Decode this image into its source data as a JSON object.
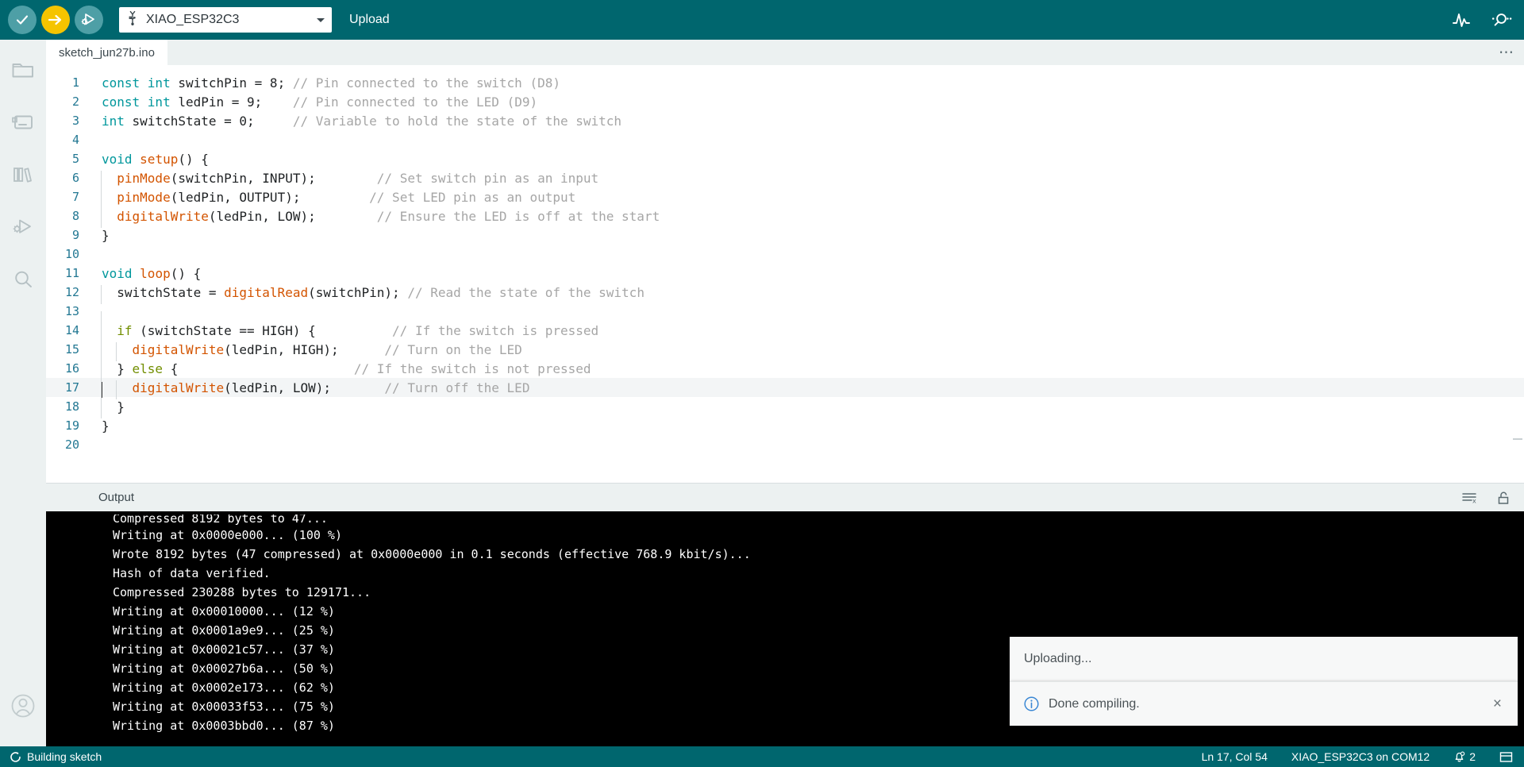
{
  "toolbar": {
    "verify_tooltip": "Verify",
    "upload_tooltip": "Upload",
    "debug_tooltip": "Debug",
    "board_name": "XIAO_ESP32C3",
    "upload_label": "Upload",
    "serial_plotter_tooltip": "Serial Plotter",
    "serial_monitor_tooltip": "Serial Monitor",
    "colors": {
      "teal": "#00666e",
      "yellow": "#f5c400",
      "muted_teal": "#4e9fa6"
    }
  },
  "sidebar": {
    "items": [
      {
        "name": "sketchbook",
        "icon": "folder-icon"
      },
      {
        "name": "boards-manager",
        "icon": "board-icon"
      },
      {
        "name": "library-manager",
        "icon": "library-icon"
      },
      {
        "name": "debug",
        "icon": "debug-icon"
      },
      {
        "name": "search",
        "icon": "search-icon"
      }
    ],
    "account_icon": "account-icon"
  },
  "tabs": {
    "active": "sketch_jun27b.ino",
    "items": [
      {
        "label": "sketch_jun27b.ino"
      }
    ],
    "overflow_label": "⋯"
  },
  "editor": {
    "active_line": 17,
    "lines": [
      {
        "n": 1,
        "tokens": [
          {
            "t": "const ",
            "c": "type"
          },
          {
            "t": "int ",
            "c": "type"
          },
          {
            "t": "switchPin = ",
            "c": "plain"
          },
          {
            "t": "8",
            "c": "num"
          },
          {
            "t": "; ",
            "c": "plain"
          },
          {
            "t": "// Pin connected to the switch (D8)",
            "c": "cmt"
          }
        ]
      },
      {
        "n": 2,
        "tokens": [
          {
            "t": "const ",
            "c": "type"
          },
          {
            "t": "int ",
            "c": "type"
          },
          {
            "t": "ledPin = ",
            "c": "plain"
          },
          {
            "t": "9",
            "c": "num"
          },
          {
            "t": ";    ",
            "c": "plain"
          },
          {
            "t": "// Pin connected to the LED (D9)",
            "c": "cmt"
          }
        ]
      },
      {
        "n": 3,
        "tokens": [
          {
            "t": "int ",
            "c": "type"
          },
          {
            "t": "switchState = ",
            "c": "plain"
          },
          {
            "t": "0",
            "c": "num"
          },
          {
            "t": ";     ",
            "c": "plain"
          },
          {
            "t": "// Variable to hold the state of the switch",
            "c": "cmt"
          }
        ]
      },
      {
        "n": 4,
        "tokens": []
      },
      {
        "n": 5,
        "tokens": [
          {
            "t": "void ",
            "c": "type"
          },
          {
            "t": "setup",
            "c": "fn"
          },
          {
            "t": "() {",
            "c": "plain"
          }
        ]
      },
      {
        "n": 6,
        "indent": 1,
        "tokens": [
          {
            "t": "  ",
            "c": "plain"
          },
          {
            "t": "pinMode",
            "c": "fn"
          },
          {
            "t": "(switchPin, INPUT);        ",
            "c": "plain"
          },
          {
            "t": "// Set switch pin as an input",
            "c": "cmt"
          }
        ]
      },
      {
        "n": 7,
        "indent": 1,
        "tokens": [
          {
            "t": "  ",
            "c": "plain"
          },
          {
            "t": "pinMode",
            "c": "fn"
          },
          {
            "t": "(ledPin, OUTPUT);         ",
            "c": "plain"
          },
          {
            "t": "// Set LED pin as an output",
            "c": "cmt"
          }
        ]
      },
      {
        "n": 8,
        "indent": 1,
        "tokens": [
          {
            "t": "  ",
            "c": "plain"
          },
          {
            "t": "digitalWrite",
            "c": "fn"
          },
          {
            "t": "(ledPin, LOW);        ",
            "c": "plain"
          },
          {
            "t": "// Ensure the LED is off at the start",
            "c": "cmt"
          }
        ]
      },
      {
        "n": 9,
        "tokens": [
          {
            "t": "}",
            "c": "plain"
          }
        ]
      },
      {
        "n": 10,
        "tokens": []
      },
      {
        "n": 11,
        "tokens": [
          {
            "t": "void ",
            "c": "type"
          },
          {
            "t": "loop",
            "c": "fn"
          },
          {
            "t": "() {",
            "c": "plain"
          }
        ]
      },
      {
        "n": 12,
        "indent": 1,
        "tokens": [
          {
            "t": "  switchState = ",
            "c": "plain"
          },
          {
            "t": "digitalRead",
            "c": "fn"
          },
          {
            "t": "(switchPin); ",
            "c": "plain"
          },
          {
            "t": "// Read the state of the switch",
            "c": "cmt"
          }
        ]
      },
      {
        "n": 13,
        "indent": 1,
        "tokens": []
      },
      {
        "n": 14,
        "indent": 1,
        "tokens": [
          {
            "t": "  ",
            "c": "plain"
          },
          {
            "t": "if",
            "c": "ctrl"
          },
          {
            "t": " (switchState == HIGH) {          ",
            "c": "plain"
          },
          {
            "t": "// If the switch is pressed",
            "c": "cmt"
          }
        ]
      },
      {
        "n": 15,
        "indent": 2,
        "tokens": [
          {
            "t": "    ",
            "c": "plain"
          },
          {
            "t": "digitalWrite",
            "c": "fn"
          },
          {
            "t": "(ledPin, HIGH);      ",
            "c": "plain"
          },
          {
            "t": "// Turn on the LED",
            "c": "cmt"
          }
        ]
      },
      {
        "n": 16,
        "indent": 1,
        "tokens": [
          {
            "t": "  } ",
            "c": "plain"
          },
          {
            "t": "else",
            "c": "ctrl"
          },
          {
            "t": " {                       ",
            "c": "plain"
          },
          {
            "t": "// If the switch is not pressed",
            "c": "cmt"
          }
        ]
      },
      {
        "n": 17,
        "indent": 2,
        "active": true,
        "tokens": [
          {
            "t": "    ",
            "c": "plain"
          },
          {
            "t": "digitalWrite",
            "c": "fn"
          },
          {
            "t": "(ledPin, LOW);       ",
            "c": "plain"
          },
          {
            "t": "// Turn off the LED",
            "c": "cmt"
          }
        ]
      },
      {
        "n": 18,
        "indent": 1,
        "tokens": [
          {
            "t": "  }",
            "c": "plain"
          }
        ]
      },
      {
        "n": 19,
        "tokens": [
          {
            "t": "}",
            "c": "plain"
          }
        ]
      },
      {
        "n": 20,
        "tokens": []
      }
    ]
  },
  "output": {
    "title": "Output",
    "clear_icon": "clear-output-icon",
    "lock_icon": "scroll-lock-icon",
    "lines": [
      "Compressed 8192 bytes to 47...",
      "Writing at 0x0000e000... (100 %)",
      "Wrote 8192 bytes (47 compressed) at 0x0000e000 in 0.1 seconds (effective 768.9 kbit/s)...",
      "Hash of data verified.",
      "Compressed 230288 bytes to 129171...",
      "Writing at 0x00010000... (12 %)",
      "Writing at 0x0001a9e9... (25 %)",
      "Writing at 0x00021c57... (37 %)",
      "Writing at 0x00027b6a... (50 %)",
      "Writing at 0x0002e173... (62 %)",
      "Writing at 0x00033f53... (75 %)",
      "Writing at 0x0003bbd0... (87 %)"
    ]
  },
  "toasts": [
    {
      "text": "Uploading...",
      "icon": null,
      "closable": false
    },
    {
      "text": "Done compiling.",
      "icon": "info-icon",
      "closable": true,
      "close_label": "×"
    }
  ],
  "status_bar": {
    "task_icon": "spinner-icon",
    "task_text": "Building sketch",
    "cursor_position": "Ln 17, Col 54",
    "board_port": "XIAO_ESP32C3 on COM12",
    "notifications_icon": "bell-icon",
    "notifications_count": "2",
    "panel_toggle_icon": "panel-layout-icon"
  }
}
